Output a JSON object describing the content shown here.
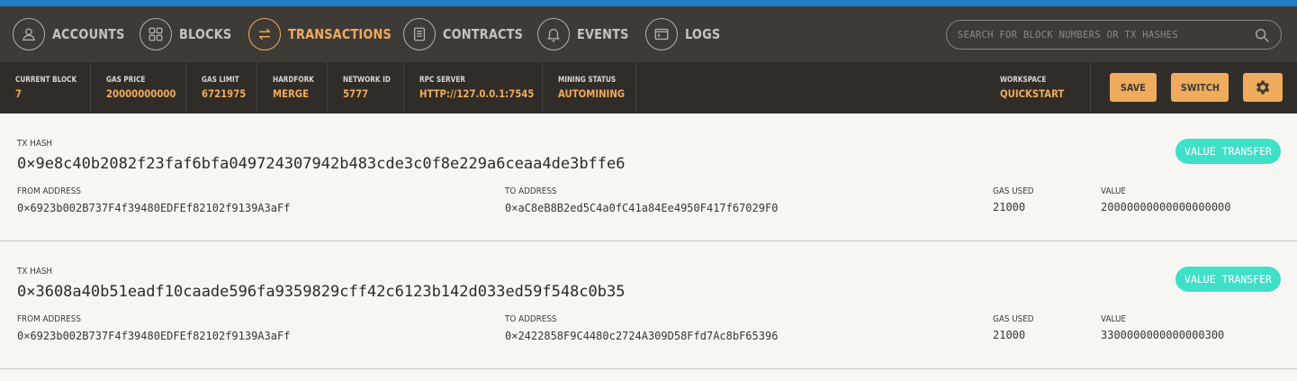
{
  "nav": {
    "items": [
      {
        "label": "ACCOUNTS",
        "icon": "account-icon"
      },
      {
        "label": "BLOCKS",
        "icon": "blocks-icon"
      },
      {
        "label": "TRANSACTIONS",
        "icon": "transactions-icon"
      },
      {
        "label": "CONTRACTS",
        "icon": "contracts-icon"
      },
      {
        "label": "EVENTS",
        "icon": "bell-icon"
      },
      {
        "label": "LOGS",
        "icon": "terminal-icon"
      }
    ],
    "active": "TRANSACTIONS",
    "search_placeholder": "SEARCH FOR BLOCK NUMBERS OR TX HASHES"
  },
  "status": {
    "current_block": {
      "label": "CURRENT BLOCK",
      "value": "7"
    },
    "gas_price": {
      "label": "GAS PRICE",
      "value": "20000000000"
    },
    "gas_limit": {
      "label": "GAS LIMIT",
      "value": "6721975"
    },
    "hardfork": {
      "label": "HARDFORK",
      "value": "MERGE"
    },
    "network_id": {
      "label": "NETWORK ID",
      "value": "5777"
    },
    "rpc_server": {
      "label": "RPC SERVER",
      "value": "HTTP://127.0.0.1:7545"
    },
    "mining_status": {
      "label": "MINING STATUS",
      "value": "AUTOMINING"
    },
    "workspace": {
      "label": "WORKSPACE",
      "value": "QUICKSTART"
    }
  },
  "buttons": {
    "save": "SAVE",
    "switch": "SWITCH"
  },
  "labels": {
    "tx_hash": "TX HASH",
    "from_address": "FROM ADDRESS",
    "to_address": "TO ADDRESS",
    "gas_used": "GAS USED",
    "value": "VALUE"
  },
  "transactions": [
    {
      "hash": "0x9e8c40b2082f23faf6bfa049724307942b483cde3c0f8e229a6ceaa4de3bffe6",
      "type": "VALUE TRANSFER",
      "from": "0x6923b002B737F4f39480EDFEf82102f9139A3aFf",
      "to": "0xaC8eB8B2ed5C4a0fC41a84Ee4950F417f67029F0",
      "gas_used": "21000",
      "value": "20000000000000000000"
    },
    {
      "hash": "0x3608a40b51eadf10caade596fa9359829cff42c6123b142d033ed59f548c0b35",
      "type": "VALUE TRANSFER",
      "from": "0x6923b002B737F4f39480EDFEf82102f9139A3aFf",
      "to": "0x2422858F9C4480c2724A309D58Ffd7Ac8bF65396",
      "gas_used": "21000",
      "value": "3300000000000000300"
    }
  ],
  "colors": {
    "accent": "#f0ab5c",
    "badge": "#3fe0c8",
    "nav_bg": "#3e3b37",
    "status_bg": "#302d29",
    "top_strip": "#1e7fcb"
  }
}
